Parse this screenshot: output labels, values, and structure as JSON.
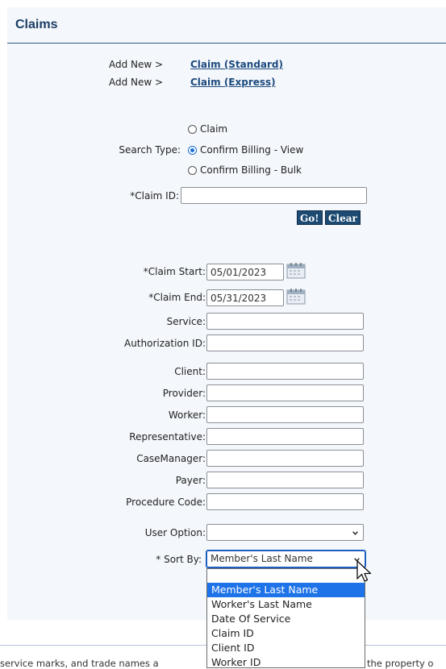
{
  "panel": {
    "title": "Claims"
  },
  "add_new": {
    "prefix": "Add New >",
    "links": [
      "Claim (Standard)",
      "Claim (Express)"
    ]
  },
  "search_type": {
    "label": "Search Type:",
    "options": [
      "Claim",
      "Confirm Billing - View",
      "Confirm Billing - Bulk"
    ],
    "selected": "Confirm Billing - View"
  },
  "claim_id": {
    "label": "*Claim ID:",
    "value": ""
  },
  "buttons": {
    "go": "Go!",
    "clear": "Clear"
  },
  "claim_start": {
    "label": "*Claim Start:",
    "value": "05/01/2023"
  },
  "claim_end": {
    "label": "*Claim End:",
    "value": "05/31/2023"
  },
  "fields": {
    "service": {
      "label": "Service:",
      "value": ""
    },
    "authorization_id": {
      "label": "Authorization ID:",
      "value": ""
    },
    "client": {
      "label": "Client:",
      "value": ""
    },
    "provider": {
      "label": "Provider:",
      "value": ""
    },
    "worker": {
      "label": "Worker:",
      "value": ""
    },
    "representative": {
      "label": "Representative:",
      "value": ""
    },
    "case_manager": {
      "label": "CaseManager:",
      "value": ""
    },
    "payer": {
      "label": "Payer:",
      "value": ""
    },
    "procedure_code": {
      "label": "Procedure Code:",
      "value": ""
    }
  },
  "user_option": {
    "label": "User Option:",
    "value": ""
  },
  "sort_by": {
    "label": "* Sort By:",
    "value": "Member's Last Name",
    "options": [
      "Member's Last Name",
      "Worker's Last Name",
      "Date Of Service",
      "Claim ID",
      "Client ID",
      "Worker ID"
    ],
    "highlighted": "Member's Last Name"
  },
  "footer": {
    "left_fragment": "service marks, and trade names a",
    "right_fragment": "the property o"
  },
  "colors": {
    "header": "#1c3d66",
    "button": "#1d4a72",
    "highlight": "#1e73e8",
    "panel_bg": "#f4f7fb"
  },
  "icons": [
    "calendar-icon",
    "chevron-down-icon",
    "mouse-cursor-icon"
  ]
}
